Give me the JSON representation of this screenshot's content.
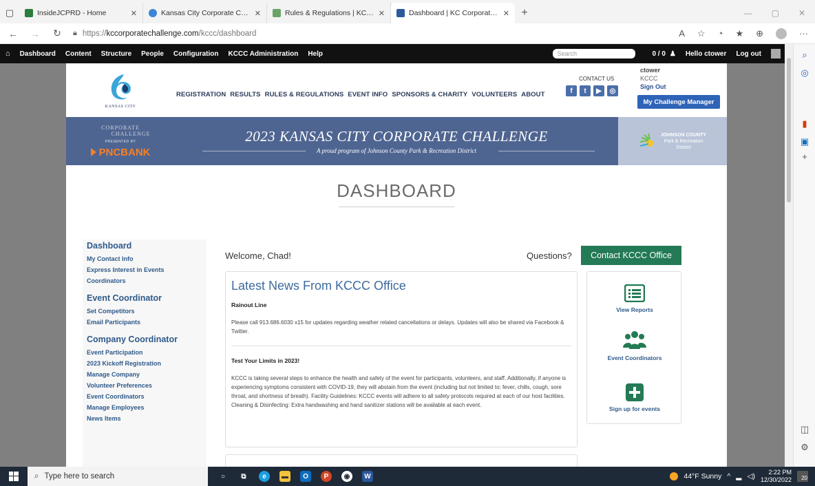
{
  "browser": {
    "tabs": [
      {
        "title": "InsideJCPRD - Home",
        "color": "#2a7d3c",
        "active": false
      },
      {
        "title": "Kansas City Corporate Challenge",
        "color": "#3a86d8",
        "active": false
      },
      {
        "title": "Rules & Regulations | KC Corporate",
        "color": "#6aa36a",
        "active": false
      },
      {
        "title": "Dashboard | KC Corporate Challenge",
        "color": "#2c5a9a",
        "active": true
      }
    ],
    "url_scheme": "https://",
    "url_host": "kccorporatechallenge.com",
    "url_path": "/kccc/dashboard"
  },
  "adminbar": {
    "items": [
      "Dashboard",
      "Content",
      "Structure",
      "People",
      "Configuration",
      "KCCC Administration",
      "Help"
    ],
    "search_placeholder": "Search",
    "counts": "0 / 0",
    "hello": "Hello ctower",
    "logout": "Log out"
  },
  "header": {
    "logo_city": "KANSAS CITY",
    "logo_banner_1": "CORPORATE",
    "logo_banner_2": "CHALLENGE",
    "presented_by": "PRESENTED BY",
    "sponsor": "PNCBANK",
    "nav": [
      "REGISTRATION",
      "RESULTS",
      "RULES & REGULATIONS",
      "EVENT INFO",
      "SPONSORS & CHARITY",
      "VOLUNTEERS",
      "ABOUT"
    ],
    "contact_us": "CONTACT US",
    "user_name": "ctower",
    "user_org": "KCCC",
    "sign_out": "Sign Out",
    "challenge_manager": "My Challenge Manager",
    "hero_title": "2023 KANSAS CITY CORPORATE CHALLENGE",
    "hero_sub": "A proud program of Johnson County Park & Recreation District",
    "jc_line1": "JOHNSON COUNTY",
    "jc_line2": "Park & Recreation",
    "jc_line3": "District"
  },
  "page": {
    "title": "DASHBOARD"
  },
  "leftnav": {
    "sections": [
      {
        "heading": "Dashboard",
        "items": [
          "My Contact Info",
          "Express Interest in Events",
          "Coordinators"
        ]
      },
      {
        "heading": "Event Coordinator",
        "items": [
          "Set Competitors",
          "Email Participants"
        ]
      },
      {
        "heading": "Company Coordinator",
        "items": [
          "Event Participation",
          "2023 Kickoff Registration",
          "Manage Company",
          "Volunteer Preferences",
          "Event Coordinators",
          "Manage Employees",
          "News Items"
        ]
      }
    ]
  },
  "main": {
    "welcome": "Welcome, Chad!",
    "questions": "Questions?",
    "contact_button": "Contact KCCC Office",
    "news_heading": "Latest News From KCCC Office",
    "news": [
      {
        "title": "Rainout Line",
        "body": "Please call 913.686.6030 x15 for updates regarding weather related cancellations or delays. Updates will also be shared via Facebook & Twitter."
      },
      {
        "title": "Test Your Limits in 2023!",
        "body": "KCCC is taking several steps to enhance the health and safety of the event for participants, volunteers, and staff. Additionally, if anyone is experiencing symptoms consistent with COVID-19, they will abstain from the event (including but not limited to: fever, chills, cough, sore throat, and shortness of breath). Facility Guidelines: KCCC events will adhere to all safety protocols required at each of our host facilities. Cleaning & Disinfecting: Extra handwashing and hand sanitizer stations will be available at each event."
      }
    ],
    "actions": [
      {
        "label": "View Reports",
        "icon": "list-icon"
      },
      {
        "label": "Event Coordinators",
        "icon": "users-icon"
      },
      {
        "label": "Sign up for events",
        "icon": "plus-square-icon"
      }
    ],
    "accent_green": "#237a54",
    "accent_blue": "#3d6a9c"
  },
  "taskbar": {
    "search_placeholder": "Type here to search",
    "weather": "44°F  Sunny",
    "time": "2:22 PM",
    "date": "12/30/2022",
    "notif_count": "20"
  }
}
